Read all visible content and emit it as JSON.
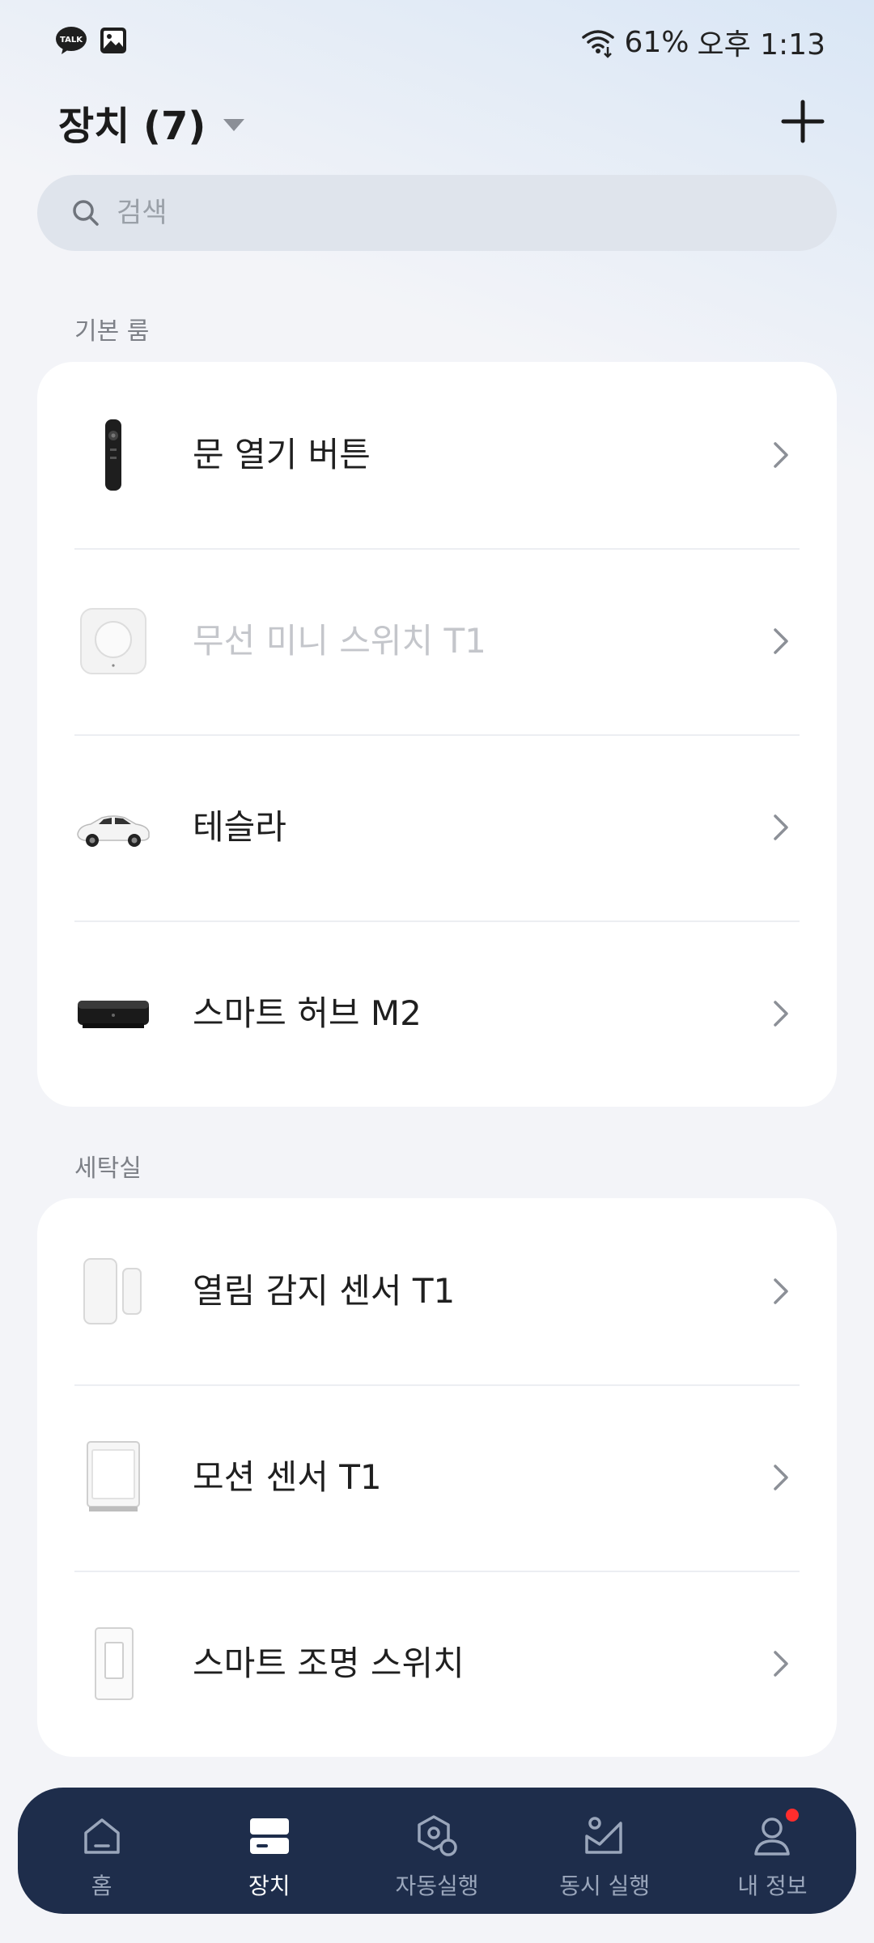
{
  "status_bar": {
    "battery": "61%",
    "time": "오후 1:13",
    "icons": [
      "kakaotalk-icon",
      "gallery-icon",
      "wifi-icon"
    ]
  },
  "header": {
    "title": "장치 (7)",
    "add_icon": "plus-icon"
  },
  "search": {
    "placeholder": "검색"
  },
  "sections": [
    {
      "label": "기본 룸",
      "devices": [
        {
          "name": "문 열기 버튼",
          "icon": "remote-icon",
          "disabled": false
        },
        {
          "name": "무선 미니 스위치 T1",
          "icon": "mini-switch-icon",
          "disabled": true
        },
        {
          "name": "테슬라",
          "icon": "car-icon",
          "disabled": false
        },
        {
          "name": "스마트 허브 M2",
          "icon": "hub-icon",
          "disabled": false
        }
      ]
    },
    {
      "label": "세탁실",
      "devices": [
        {
          "name": "열림 감지 센서 T1",
          "icon": "door-sensor-icon",
          "disabled": false
        },
        {
          "name": "모션 센서 T1",
          "icon": "motion-sensor-icon",
          "disabled": false
        },
        {
          "name": "스마트 조명 스위치",
          "icon": "light-switch-icon",
          "disabled": false
        }
      ]
    }
  ],
  "bottom_nav": {
    "items": [
      {
        "label": "홈",
        "icon": "home-icon"
      },
      {
        "label": "장치",
        "icon": "devices-icon"
      },
      {
        "label": "자동실행",
        "icon": "automation-icon"
      },
      {
        "label": "동시 실행",
        "icon": "scene-icon"
      },
      {
        "label": "내 정보",
        "icon": "profile-icon"
      }
    ],
    "active": "장치"
  },
  "colors": {
    "nav_bg": "#1e2d4b",
    "notification_dot": "#ff2d2d",
    "search_bg": "#dfe4ec"
  }
}
